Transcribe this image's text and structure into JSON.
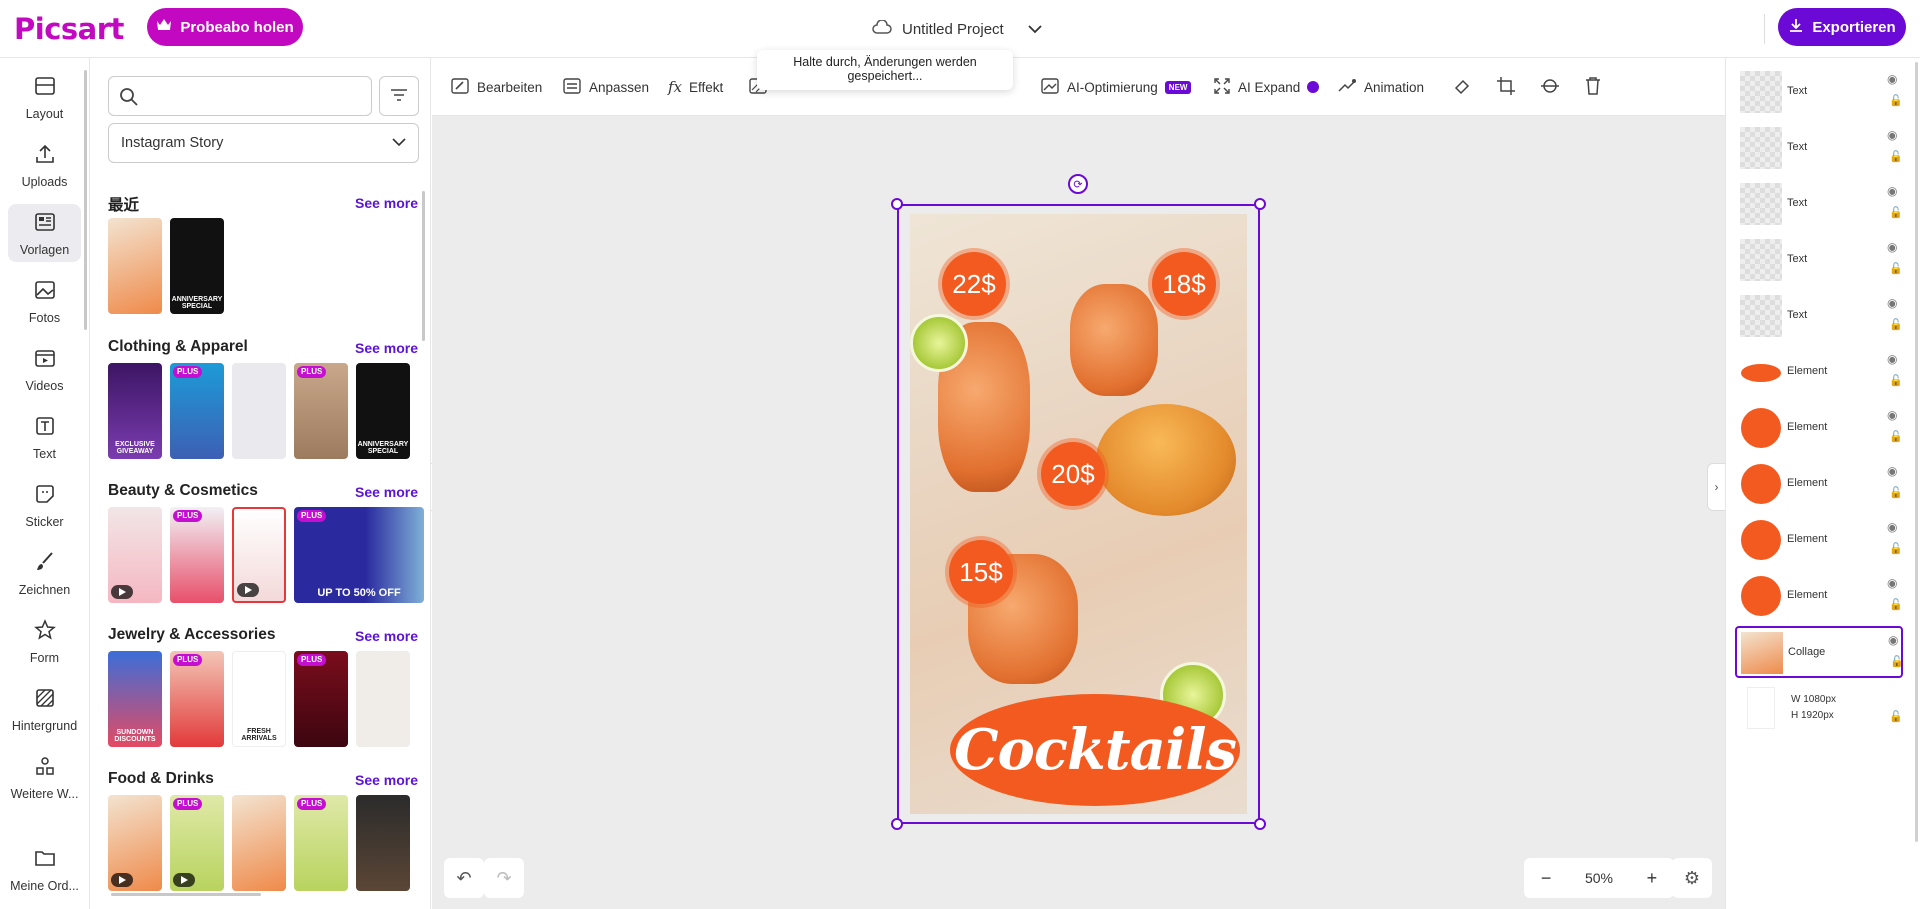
{
  "header": {
    "logo": "Picsart",
    "trial_button": "Probeabo holen",
    "project_title": "Untitled Project",
    "export_button": "Exportieren"
  },
  "left_nav": {
    "items": [
      {
        "label": "Layout",
        "icon": "layout-icon"
      },
      {
        "label": "Uploads",
        "icon": "upload-icon"
      },
      {
        "label": "Vorlagen",
        "icon": "templates-icon",
        "active": true
      },
      {
        "label": "Fotos",
        "icon": "photo-icon"
      },
      {
        "label": "Videos",
        "icon": "video-icon"
      },
      {
        "label": "Text",
        "icon": "text-icon"
      },
      {
        "label": "Sticker",
        "icon": "sticker-icon"
      },
      {
        "label": "Zeichnen",
        "icon": "brush-icon"
      },
      {
        "label": "Form",
        "icon": "star-icon"
      },
      {
        "label": "Hintergrund",
        "icon": "background-icon"
      },
      {
        "label": "Weitere W...",
        "icon": "apps-icon"
      },
      {
        "label": "Meine Ord...",
        "icon": "folder-icon"
      }
    ]
  },
  "panel": {
    "search_placeholder": "",
    "format_select": "Instagram Story",
    "sections": [
      {
        "title": "最近",
        "see_more": "See more"
      },
      {
        "title": "Clothing & Apparel",
        "see_more": "See more"
      },
      {
        "title": "Beauty & Cosmetics",
        "see_more": "See more"
      },
      {
        "title": "Jewelry & Accessories",
        "see_more": "See more"
      },
      {
        "title": "Food & Drinks",
        "see_more": "See more"
      }
    ],
    "thumb_texts": {
      "anniversary": "ANNIVERSARY SPECIAL",
      "giveaway": "EXCLUSIVE GIVEAWAY",
      "sundown": "SUNDOWN DISCOUNTS",
      "upto50": "UP TO 50% OFF",
      "fresh": "FRESH ARRIVALS",
      "plus": "PLUS"
    }
  },
  "toolbar": {
    "tools": [
      {
        "label": "Bearbeiten",
        "icon": "edit-icon"
      },
      {
        "label": "Anpassen",
        "icon": "adjust-icon"
      },
      {
        "label": "Effekt",
        "icon": "fx-icon"
      },
      {
        "label": "AI-Optimierung",
        "icon": "ai-enhance-icon",
        "badge": "NEW"
      },
      {
        "label": "AI Expand",
        "icon": "expand-icon"
      },
      {
        "label": "Animation",
        "icon": "animation-icon"
      }
    ],
    "save_tooltip": "Halte durch, Änderungen werden gespeichert..."
  },
  "design": {
    "prices": [
      "22$",
      "18$",
      "20$",
      "15$"
    ],
    "title": "Cocktails"
  },
  "zoom": {
    "level": "50%"
  },
  "layers": [
    {
      "name": "Text",
      "type": "text"
    },
    {
      "name": "Text",
      "type": "text"
    },
    {
      "name": "Text",
      "type": "text"
    },
    {
      "name": "Text",
      "type": "text"
    },
    {
      "name": "Text",
      "type": "text"
    },
    {
      "name": "Element",
      "type": "oval"
    },
    {
      "name": "Element",
      "type": "badge"
    },
    {
      "name": "Element",
      "type": "badge"
    },
    {
      "name": "Element",
      "type": "badge"
    },
    {
      "name": "Element",
      "type": "badge"
    },
    {
      "name": "Collage",
      "type": "collage",
      "selected": true
    },
    {
      "name": "",
      "type": "background",
      "w": "W  1080px",
      "h": "H  1920px"
    }
  ],
  "colors": {
    "brand_magenta": "#c209c1",
    "accent_purple": "#6b0ad6",
    "price_orange": "#f25a1f"
  }
}
